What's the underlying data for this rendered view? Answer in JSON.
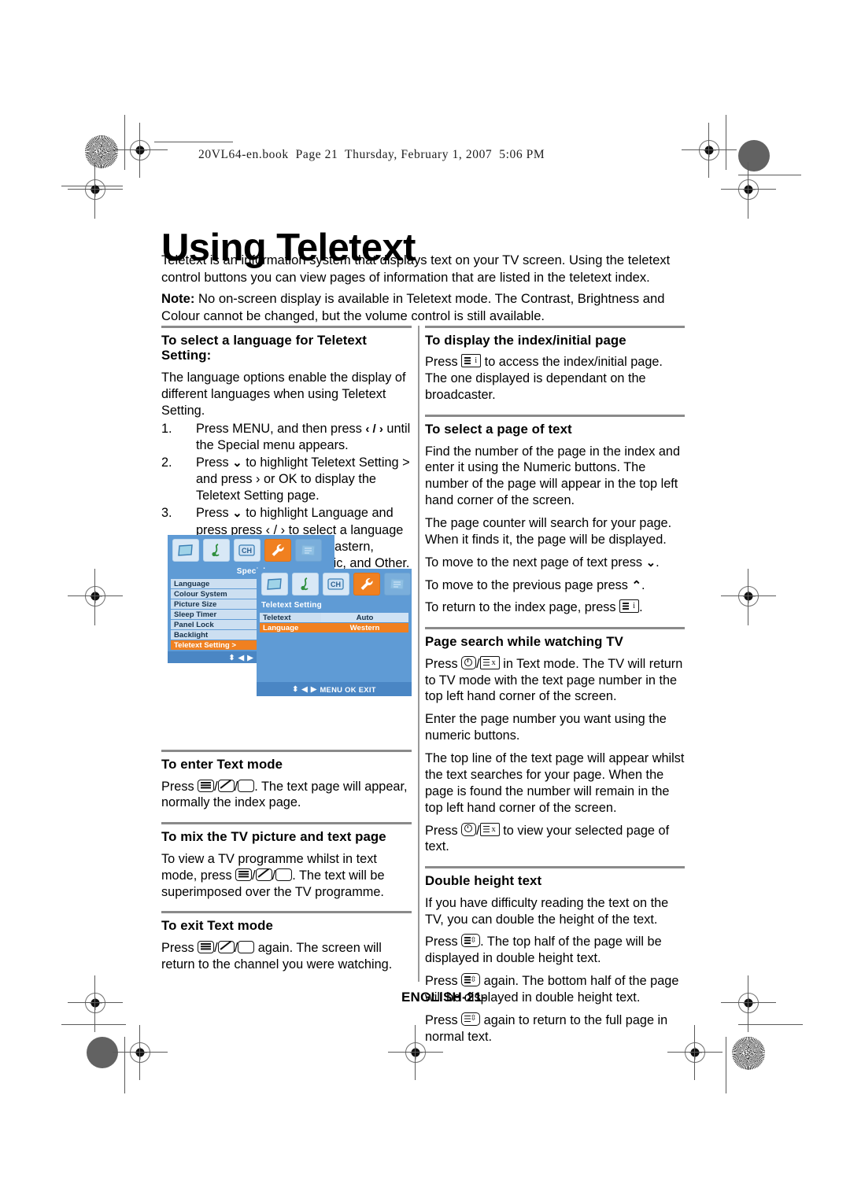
{
  "header": {
    "book_line": "20VL64-en.book  Page 21  Thursday, February 1, 2007  5:06 PM"
  },
  "page": {
    "title": "Using Teletext",
    "intro_1": "Teletext is an information system that displays text on your TV screen. Using the teletext control buttons you can view pages of information that are listed in the teletext index.",
    "note_label": "Note:",
    "intro_2": " No on-screen display is available in Teletext mode. The Contrast, Brightness and Colour cannot be changed, but the volume control is still available.",
    "footer_lang": "ENGLISH",
    "footer_page": "-21-"
  },
  "left_column": {
    "section_language": {
      "heading": "To select a language for Teletext Setting:",
      "intro": "The language options enable the display of different languages when using Teletext Setting.",
      "steps": [
        {
          "num": "1.",
          "text_a": "Press MENU, and then press ",
          "arrows": "‹ / ›",
          "text_b": " until the Special menu appears."
        },
        {
          "num": "2.",
          "text_a": "Press ",
          "arrows": "⌄",
          "text_b": " to highlight Teletext Setting > and press › or OK to display the Teletext Setting page."
        },
        {
          "num": "3.",
          "text_a": "Press ",
          "arrows": "⌄",
          "text_b": " to highlight Language and press press ‹ / › to select a language from among: Western, Eastern, Cyrillic 1, Cyrillic 2, Arabic, and Other."
        }
      ]
    },
    "section_enter_text": {
      "heading": "To enter Text mode",
      "text_a": "Press ",
      "text_b": ". The text page will appear, normally the index page."
    },
    "section_mix": {
      "heading": "To mix the TV picture and text page",
      "text_a": "To view a TV programme whilst in text mode, press ",
      "text_b": ". The text will be superimposed over the TV programme."
    },
    "section_exit": {
      "heading": "To exit Text mode",
      "text_a": "Press ",
      "text_b": " again. The screen will return to the channel you were watching."
    }
  },
  "right_column": {
    "section_index": {
      "heading": "To display the index/initial page",
      "text_a": "Press ",
      "text_b": " to access the index/initial page. The one displayed is dependant on the broadcaster."
    },
    "section_select_page": {
      "heading": "To select a page of text",
      "para_1": "Find the number of the page in the index and enter it using the Numeric buttons. The number of the page will appear in the top left hand corner of the screen.",
      "para_2": "The page counter will search for your page. When it finds it, the page will be displayed.",
      "para_3_a": "To move to the next page of text press ",
      "para_3_arrow": "⌄",
      "para_3_b": ".",
      "para_4_a": "To move to the previous page press ",
      "para_4_arrow": "⌃",
      "para_4_b": ".",
      "para_5_a": "To return to the index page, press ",
      "para_5_b": "."
    },
    "section_page_search": {
      "heading": "Page search while watching TV",
      "para_1_a": "Press ",
      "para_1_sep": "/",
      "para_1_b": " in Text mode. The TV will return to TV mode with the text page number in the top left hand corner of the screen.",
      "para_2": "Enter the page number you want using the numeric buttons.",
      "para_3": "The top line of the text page will appear whilst the text searches for your page. When the page is found the number will remain in the top left hand corner of the screen.",
      "para_4_a": "Press ",
      "para_4_b": " to view your selected page of text."
    },
    "section_double_height": {
      "heading": "Double height text",
      "para_1": "If you have difficulty reading the text on the TV, you can double the height of the text.",
      "para_2_a": "Press ",
      "para_2_b": ". The top half of the page will be displayed in double height text.",
      "para_3_a": "Press ",
      "para_3_b": " again. The bottom half of the page will be displayed in double height text.",
      "para_4_a": "Press ",
      "para_4_b": " again to return to the full page in normal text."
    }
  },
  "osd": {
    "panel_special": {
      "title": "Special",
      "icons": [
        "picture-icon",
        "sound-icon",
        "channel-icon",
        "special-icon",
        "teletext-icon"
      ],
      "selected_icon_index": 3,
      "rows": [
        {
          "label": "Language",
          "value": "",
          "highlight": false
        },
        {
          "label": "Colour System",
          "value": "",
          "highlight": false
        },
        {
          "label": "Picture Size",
          "value": "",
          "highlight": false
        },
        {
          "label": "Sleep Timer",
          "value": "",
          "highlight": false
        },
        {
          "label": "Panel Lock",
          "value": "",
          "highlight": false
        },
        {
          "label": "Backlight",
          "value": "",
          "highlight": false
        },
        {
          "label": "Teletext Setting >",
          "value": "",
          "highlight": true
        }
      ],
      "footer": "MEN"
    },
    "panel_teletext": {
      "title": "Teletext Setting",
      "icons": [
        "picture-icon",
        "sound-icon",
        "channel-icon",
        "special-icon",
        "teletext-icon"
      ],
      "selected_icon_index": 3,
      "rows": [
        {
          "label": "Teletext",
          "value": "Auto",
          "highlight": false
        },
        {
          "label": "Language",
          "value": "Western",
          "highlight": true
        }
      ],
      "footer": "MENU OK EXIT"
    }
  },
  "colors": {
    "osd_blue": "#5f9bd5",
    "osd_blue_dark": "#4a86c4",
    "osd_highlight_orange": "#f08020",
    "osd_row_light": "#ccdff1",
    "rule_grey": "#8a8a8a"
  }
}
